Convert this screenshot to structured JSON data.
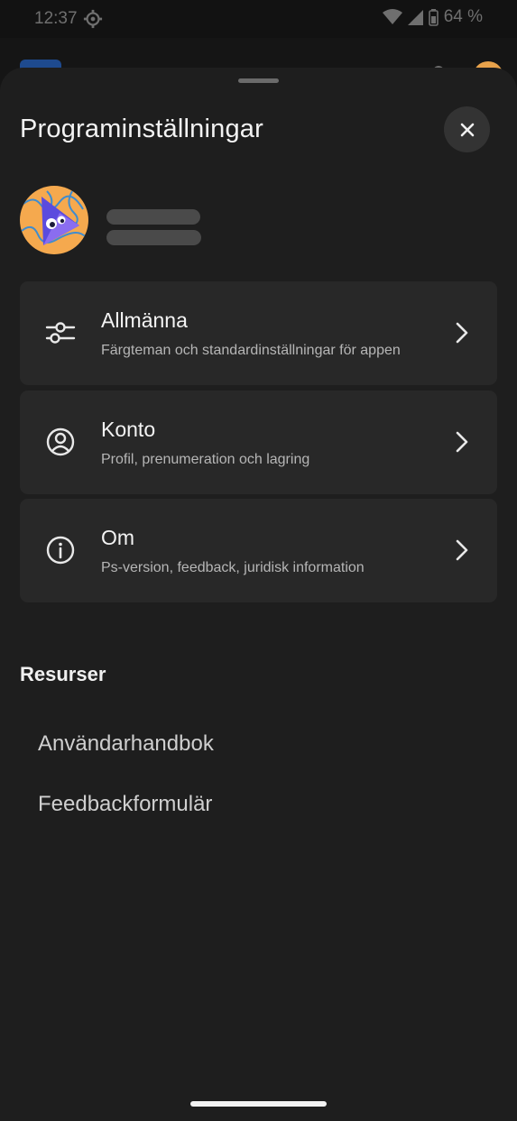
{
  "status_bar": {
    "time": "12:37",
    "battery": "64 %"
  },
  "sheet": {
    "title": "Programinställningar",
    "close_icon": "close-icon"
  },
  "menu": [
    {
      "icon": "sliders-icon",
      "title": "Allmänna",
      "subtitle": "Färgteman och standardinställningar för appen"
    },
    {
      "icon": "user-circle-icon",
      "title": "Konto",
      "subtitle": "Profil, prenumeration och lagring"
    },
    {
      "icon": "info-icon",
      "title": "Om",
      "subtitle": "Ps-version, feedback, juridisk information"
    }
  ],
  "resources": {
    "heading": "Resurser",
    "links": [
      "Användarhandbok",
      "Feedbackformulär"
    ]
  },
  "colors": {
    "sheet_background": "#1e1e1e",
    "card_background": "#282828",
    "avatar_background": "#f5a94e",
    "avatar_accent": "#5b4bde"
  }
}
